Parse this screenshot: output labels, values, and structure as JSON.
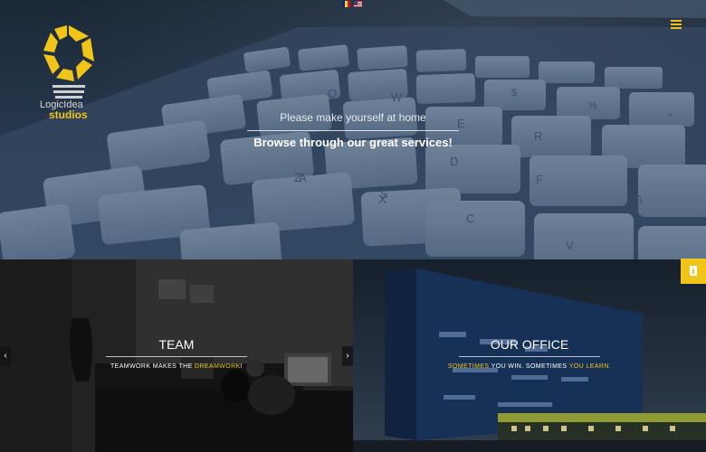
{
  "header": {
    "languages": [
      "ro",
      "en"
    ],
    "menu_icon": "hamburger-icon"
  },
  "logo": {
    "line1": "LogicIdea",
    "line2": "studios",
    "icon": "lightbulb-aperture-logo"
  },
  "hero": {
    "welcome": "Please make yourself at home",
    "tagline": "Browse through our great services!"
  },
  "panels": {
    "team": {
      "title": "TEAM",
      "subtitle_pre": "TEAMWORK MAKES THE ",
      "subtitle_hl": "DREAMWORK",
      "subtitle_post": "!"
    },
    "office": {
      "title": "OUR OFFICE",
      "subtitle_hl1": "SOMETIMES",
      "subtitle_mid": " YOU WIN. SOMETIMES ",
      "subtitle_hl2": "YOU LEARN."
    }
  },
  "controls": {
    "prev_label": "‹",
    "next_label": "›",
    "info_icon": "info-icon"
  },
  "colors": {
    "accent": "#f0c419",
    "hero_bg": "#2f4259"
  }
}
